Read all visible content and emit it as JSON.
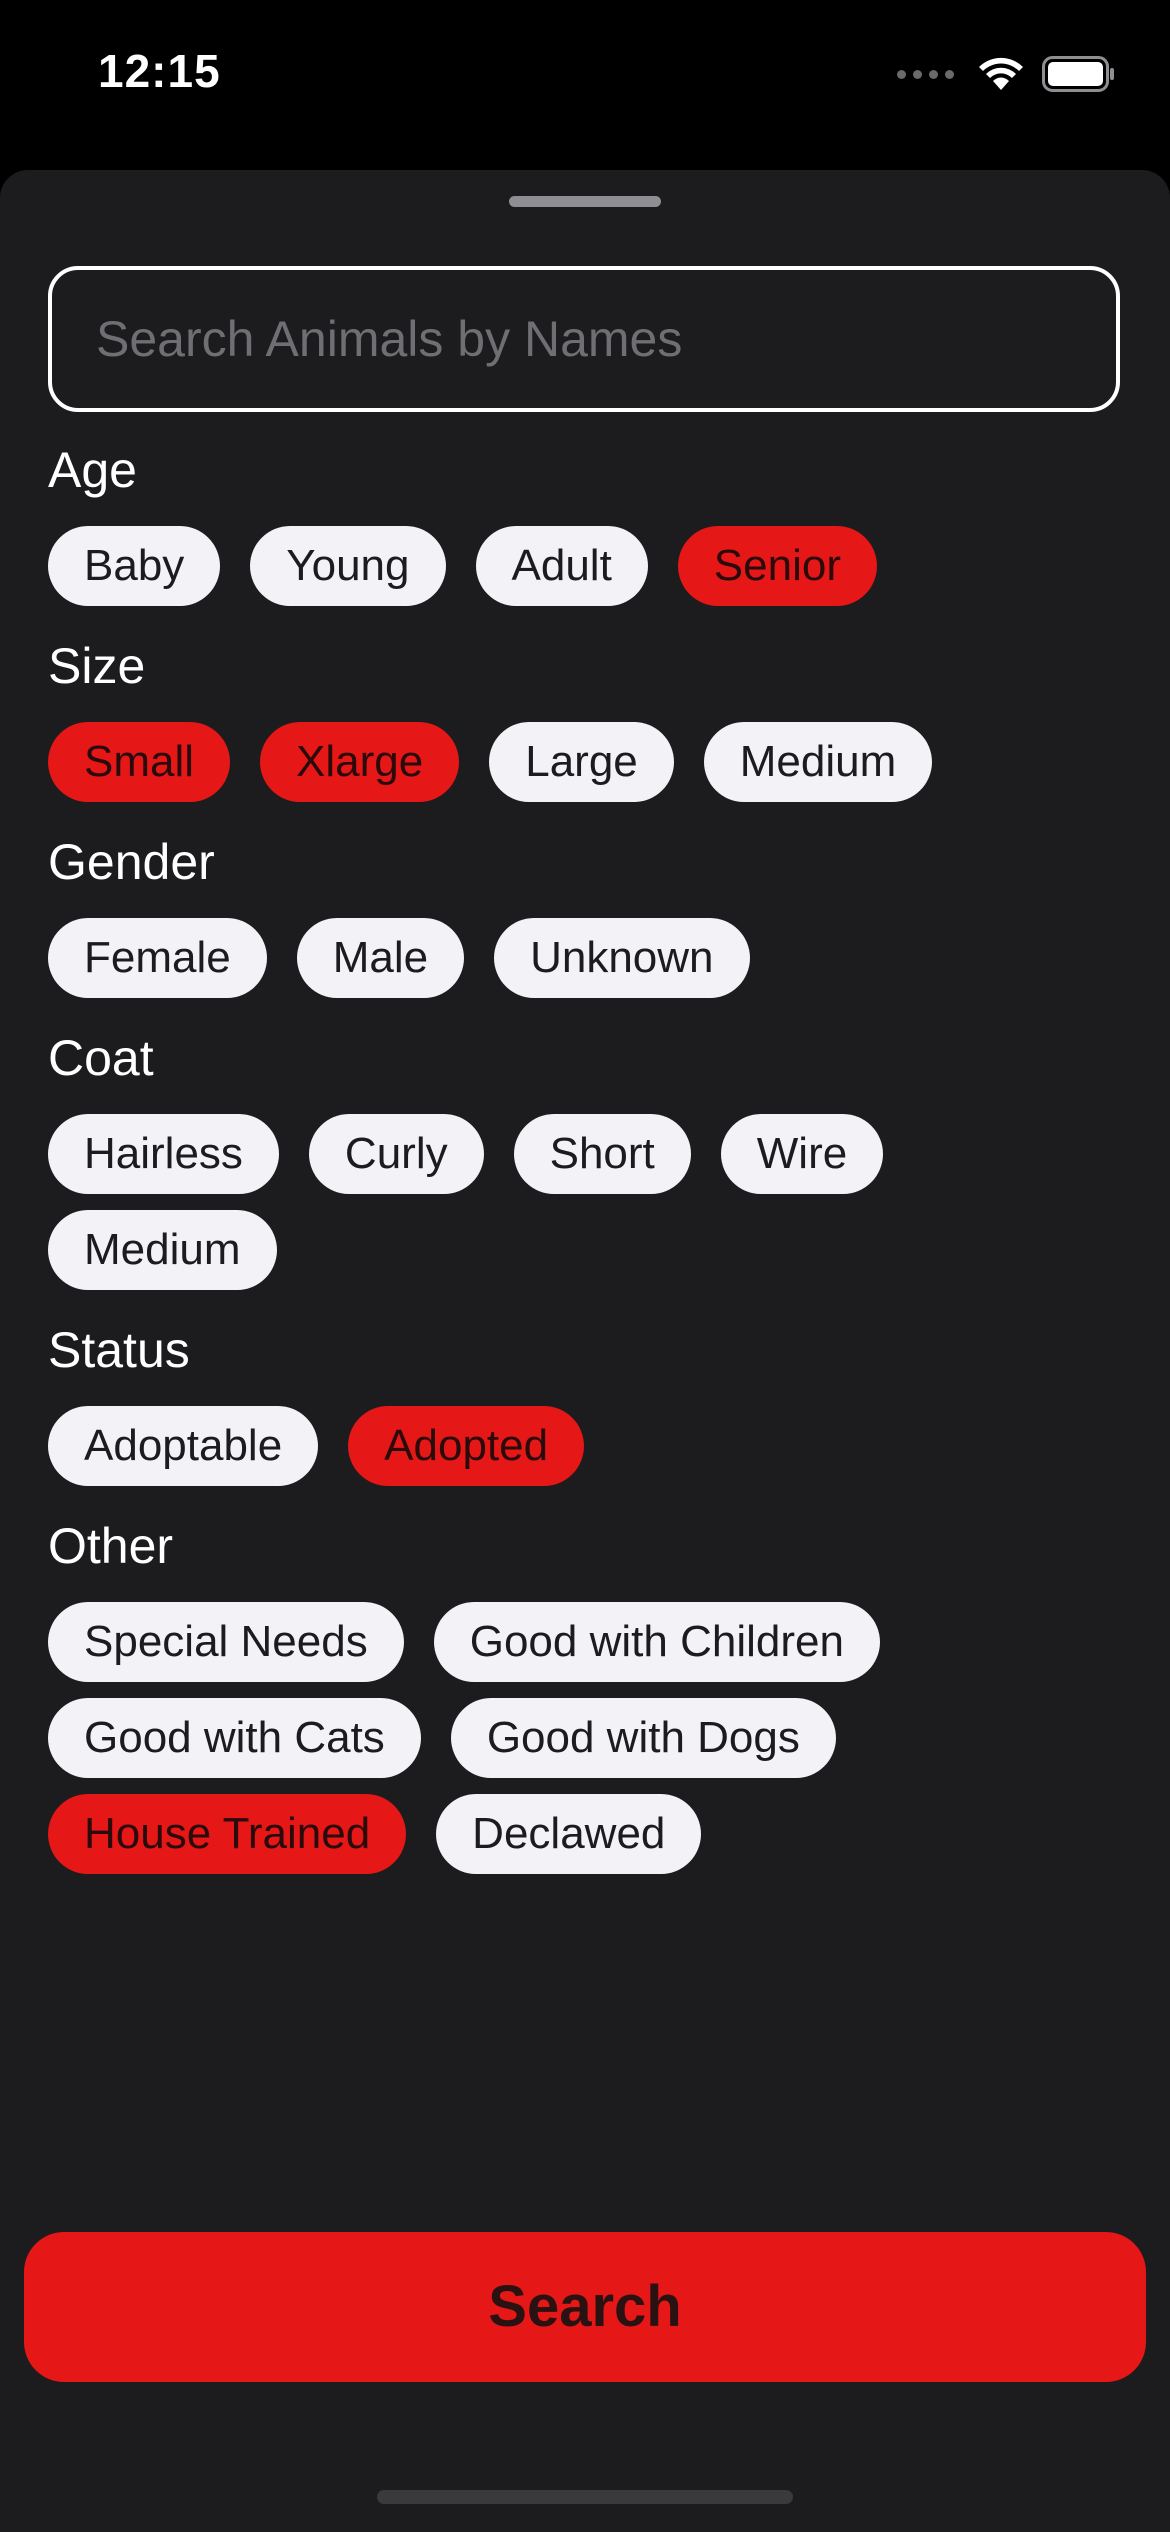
{
  "status_bar": {
    "time": "12:15"
  },
  "search": {
    "placeholder": "Search Animals by Names",
    "value": ""
  },
  "filters": {
    "age": {
      "title": "Age",
      "options": [
        {
          "label": "Baby",
          "selected": false
        },
        {
          "label": "Young",
          "selected": false
        },
        {
          "label": "Adult",
          "selected": false
        },
        {
          "label": "Senior",
          "selected": true
        }
      ]
    },
    "size": {
      "title": "Size",
      "options": [
        {
          "label": "Small",
          "selected": true
        },
        {
          "label": "Xlarge",
          "selected": true
        },
        {
          "label": "Large",
          "selected": false
        },
        {
          "label": "Medium",
          "selected": false
        }
      ]
    },
    "gender": {
      "title": "Gender",
      "options": [
        {
          "label": "Female",
          "selected": false
        },
        {
          "label": "Male",
          "selected": false
        },
        {
          "label": "Unknown",
          "selected": false
        }
      ]
    },
    "coat": {
      "title": "Coat",
      "options": [
        {
          "label": "Hairless",
          "selected": false
        },
        {
          "label": "Curly",
          "selected": false
        },
        {
          "label": "Short",
          "selected": false
        },
        {
          "label": "Wire",
          "selected": false
        },
        {
          "label": "Medium",
          "selected": false
        }
      ]
    },
    "status": {
      "title": "Status",
      "options": [
        {
          "label": "Adoptable",
          "selected": false
        },
        {
          "label": "Adopted",
          "selected": true
        }
      ]
    },
    "other": {
      "title": "Other",
      "options": [
        {
          "label": "Special Needs",
          "selected": false
        },
        {
          "label": "Good with Children",
          "selected": false
        },
        {
          "label": "Good with Cats",
          "selected": false
        },
        {
          "label": "Good with Dogs",
          "selected": false
        },
        {
          "label": "House Trained",
          "selected": true
        },
        {
          "label": "Declawed",
          "selected": false
        }
      ]
    }
  },
  "search_button": {
    "label": "Search"
  },
  "colors": {
    "accent": "#e51717",
    "sheet_background": "#1c1c1e",
    "chip_background": "#f2f2f7"
  }
}
